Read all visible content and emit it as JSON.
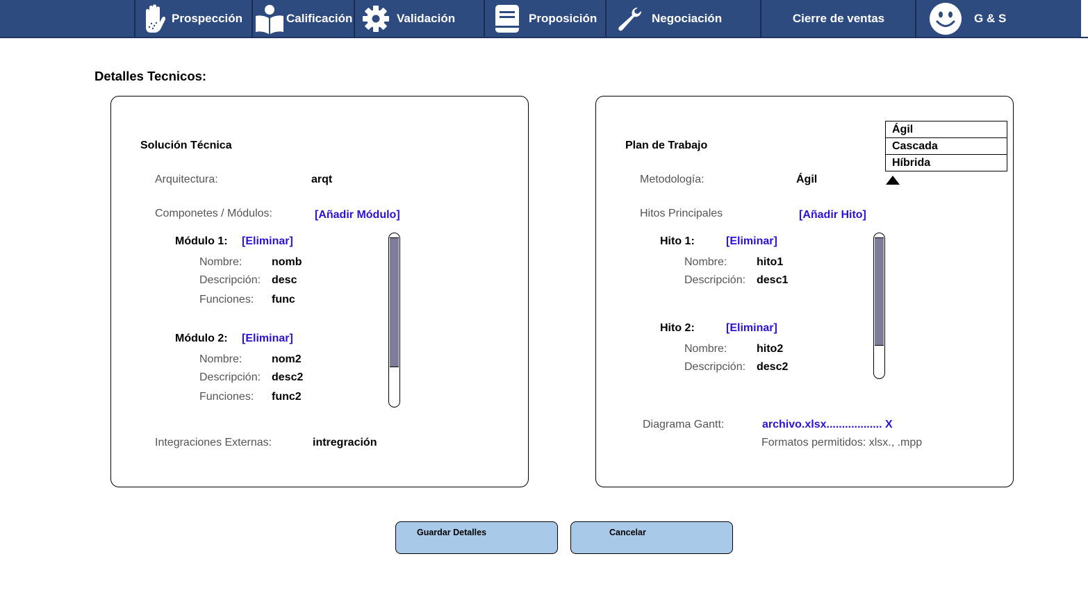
{
  "nav": {
    "items": [
      {
        "label": "Prospección",
        "icon": "hand-icon"
      },
      {
        "label": "Calificación",
        "icon": "reader-icon"
      },
      {
        "label": "Validación",
        "icon": "gear-icon"
      },
      {
        "label": "Proposición",
        "icon": "document-icon"
      },
      {
        "label": "Negociación",
        "icon": "wrench-icon"
      },
      {
        "label": "Cierre de ventas",
        "icon": ""
      },
      {
        "label": "G & S",
        "icon": "smiley-icon"
      }
    ]
  },
  "page": {
    "title": "Detalles Tecnicos:"
  },
  "solucion": {
    "title": "Solución Técnica",
    "arquitectura_label": "Arquitectura:",
    "arquitectura_value": "arqt",
    "componentes_label": "Componetes / Módulos:",
    "add_module_link": "[Añadir Módulo]",
    "modules": [
      {
        "title": "Módulo 1:",
        "delete": "[Eliminar]",
        "nombre_label": "Nombre:",
        "nombre": "nomb",
        "desc_label": "Descripción:",
        "desc": "desc",
        "func_label": "Funciones:",
        "func": "func"
      },
      {
        "title": "Módulo 2:",
        "delete": "[Eliminar]",
        "nombre_label": "Nombre:",
        "nombre": "nom2",
        "desc_label": "Descripción:",
        "desc": "desc2",
        "func_label": "Funciones:",
        "func": "func2"
      }
    ],
    "integraciones_label": "Integraciones Externas:",
    "integraciones_value": "intregración"
  },
  "plan": {
    "title": "Plan de Trabajo",
    "metodologia_label": "Metodología:",
    "metodologia_value": "Ágil",
    "metodologia_options": [
      "Ágil",
      "Cascada",
      "Híbrida"
    ],
    "hitos_label": "Hitos Principales",
    "add_hito_link": "[Añadir Hito]",
    "hitos": [
      {
        "title": "Hito 1:",
        "delete": "[Eliminar]",
        "nombre_label": "Nombre:",
        "nombre": "hito1",
        "desc_label": "Descripción:",
        "desc": "desc1"
      },
      {
        "title": "Hito 2:",
        "delete": "[Eliminar]",
        "nombre_label": "Nombre:",
        "nombre": "hito2",
        "desc_label": "Descripción:",
        "desc": "desc2"
      }
    ],
    "gantt_label": "Diagrama Gantt:",
    "gantt_file": "archivo.xlsx.................. X",
    "gantt_formats": "Formatos permitidos: xlsx., .mpp"
  },
  "actions": {
    "save": "Guardar Detalles",
    "cancel": "Cancelar"
  },
  "colors": {
    "nav_bg": "#2e4b80",
    "link": "#2a12d6",
    "button_bg": "#a9c9e8",
    "scroll_thumb": "#7e7d99"
  }
}
